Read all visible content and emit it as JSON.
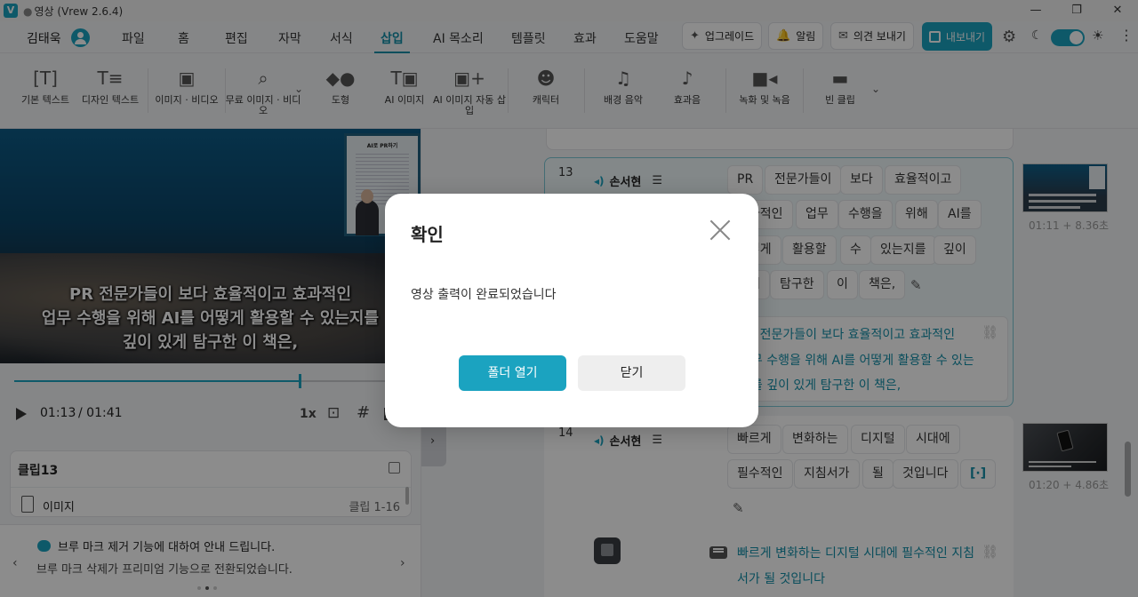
{
  "window": {
    "title": "영상",
    "version": "(Vrew 2.6.4)",
    "logo": "V",
    "controls": [
      "—",
      "❐",
      "✕"
    ]
  },
  "menubar": {
    "user": "김태욱",
    "items": [
      "파일",
      "홈",
      "편집",
      "자막",
      "서식",
      "삽입",
      "AI 목소리",
      "템플릿",
      "효과",
      "도움말"
    ],
    "active": "삽입",
    "upgrade": "업그레이드",
    "alarm": "알림",
    "feedback": "의견 보내기",
    "export": "내보내기",
    "accent_color": "#1ba3c0"
  },
  "toolbar": {
    "tools": [
      "기본 텍스트",
      "디자인 텍스트",
      "이미지 · 비디오",
      "무료 이미지 · 비디오",
      "도형",
      "AI 이미지",
      "AI 이미지 자동 삽입",
      "캐릭터",
      "배경 음악",
      "효과음",
      "녹화 및 녹음",
      "빈 클립"
    ]
  },
  "player": {
    "subtitle_lines": [
      "PR 전문가들이 보다 효율적이고 효과적인",
      "업무 수행을 위해 AI를 어떻게 활용할 수 있는지를",
      "깊이 있게 탐구한 이 책은,"
    ],
    "pip_title": "AI로 PR하기",
    "current_time": "01:13",
    "total_time": "/ 01:41",
    "speed": "1x",
    "progress": 0.73
  },
  "clip_info": {
    "title": "클립13",
    "type": "이미지",
    "range": "클립 1-16"
  },
  "notice": {
    "title": "브루 마크 제거 기능에 대하여 안내 드립니다.",
    "body": "브루 마크 삭제가 프리미엄 기능으로 전환되었습니다."
  },
  "clips": [
    {
      "number": "13",
      "speaker": "손서현",
      "words": [
        "PR",
        "전문가들이",
        "보다",
        "효율적이고",
        "효과적인",
        "업무",
        "수행을",
        "위해",
        "AI를",
        "어떻게",
        "활용할",
        "수",
        "있는지를",
        "깊이",
        "있게",
        "탐구한",
        "이",
        "책은,"
      ],
      "subtitle": [
        "PR 전문가들이 보다 효율적이고 효과적인",
        "업무 수행을 위해 AI를 어떻게 활용할 수 있는",
        "지를 깊이 있게 탐구한 이 책은,"
      ],
      "thumb_caption": "01:11 + 8.36초"
    },
    {
      "number": "14",
      "speaker": "손서현",
      "words": [
        "빠르게",
        "변화하는",
        "디지털",
        "시대에",
        "필수적인",
        "지침서가",
        "될",
        "것입니다",
        "[·]"
      ],
      "subtitle": [
        "빠르게 변화하는 디지털 시대에 필수적인 지침",
        "서가 될 것입니다"
      ],
      "thumb_caption": "01:20 + 4.86초"
    }
  ],
  "dialog": {
    "title": "확인",
    "message": "영상 출력이 완료되었습니다",
    "primary": "폴더 열기",
    "secondary": "닫기"
  }
}
